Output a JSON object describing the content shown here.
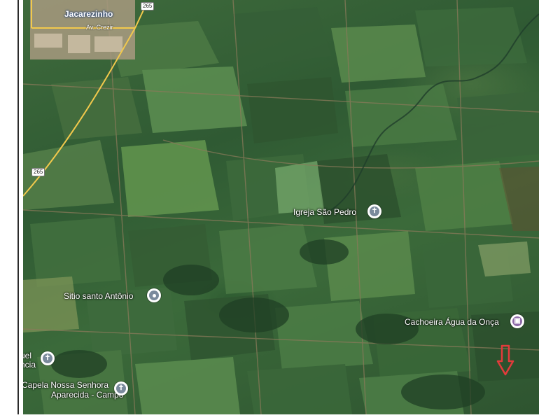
{
  "map": {
    "type": "satellite",
    "labels": {
      "city": "Jacarezinho",
      "street": "Av. Crezir",
      "road_north": "265",
      "road_west": "265"
    },
    "places": [
      {
        "id": "igreja-sao-pedro",
        "name": "Igreja São Pedro",
        "icon": "church-icon",
        "color": "#7a8a9c"
      },
      {
        "id": "sitio-santo-antonio",
        "name": "Sitio santo Antônio",
        "icon": "place-icon",
        "color": "#7a8a9c"
      },
      {
        "id": "cachoeira-agua-da-onca",
        "name": "Cachoeira Água da Onça",
        "icon": "photo-icon",
        "color": "#8e6aa8"
      },
      {
        "id": "capela-nossa-senhora",
        "name_line1": "Capela Nossa Senhora",
        "name_line2": "Aparecida - Campo",
        "icon": "church-icon",
        "color": "#7a8a9c"
      },
      {
        "id": "manuel-left",
        "name_line1": "uel",
        "name_line2": "ncia",
        "icon": "church-icon",
        "color": "#7a8a9c"
      }
    ],
    "marker": {
      "icon": "red-down-arrow-icon",
      "color": "#e23b3b"
    }
  }
}
